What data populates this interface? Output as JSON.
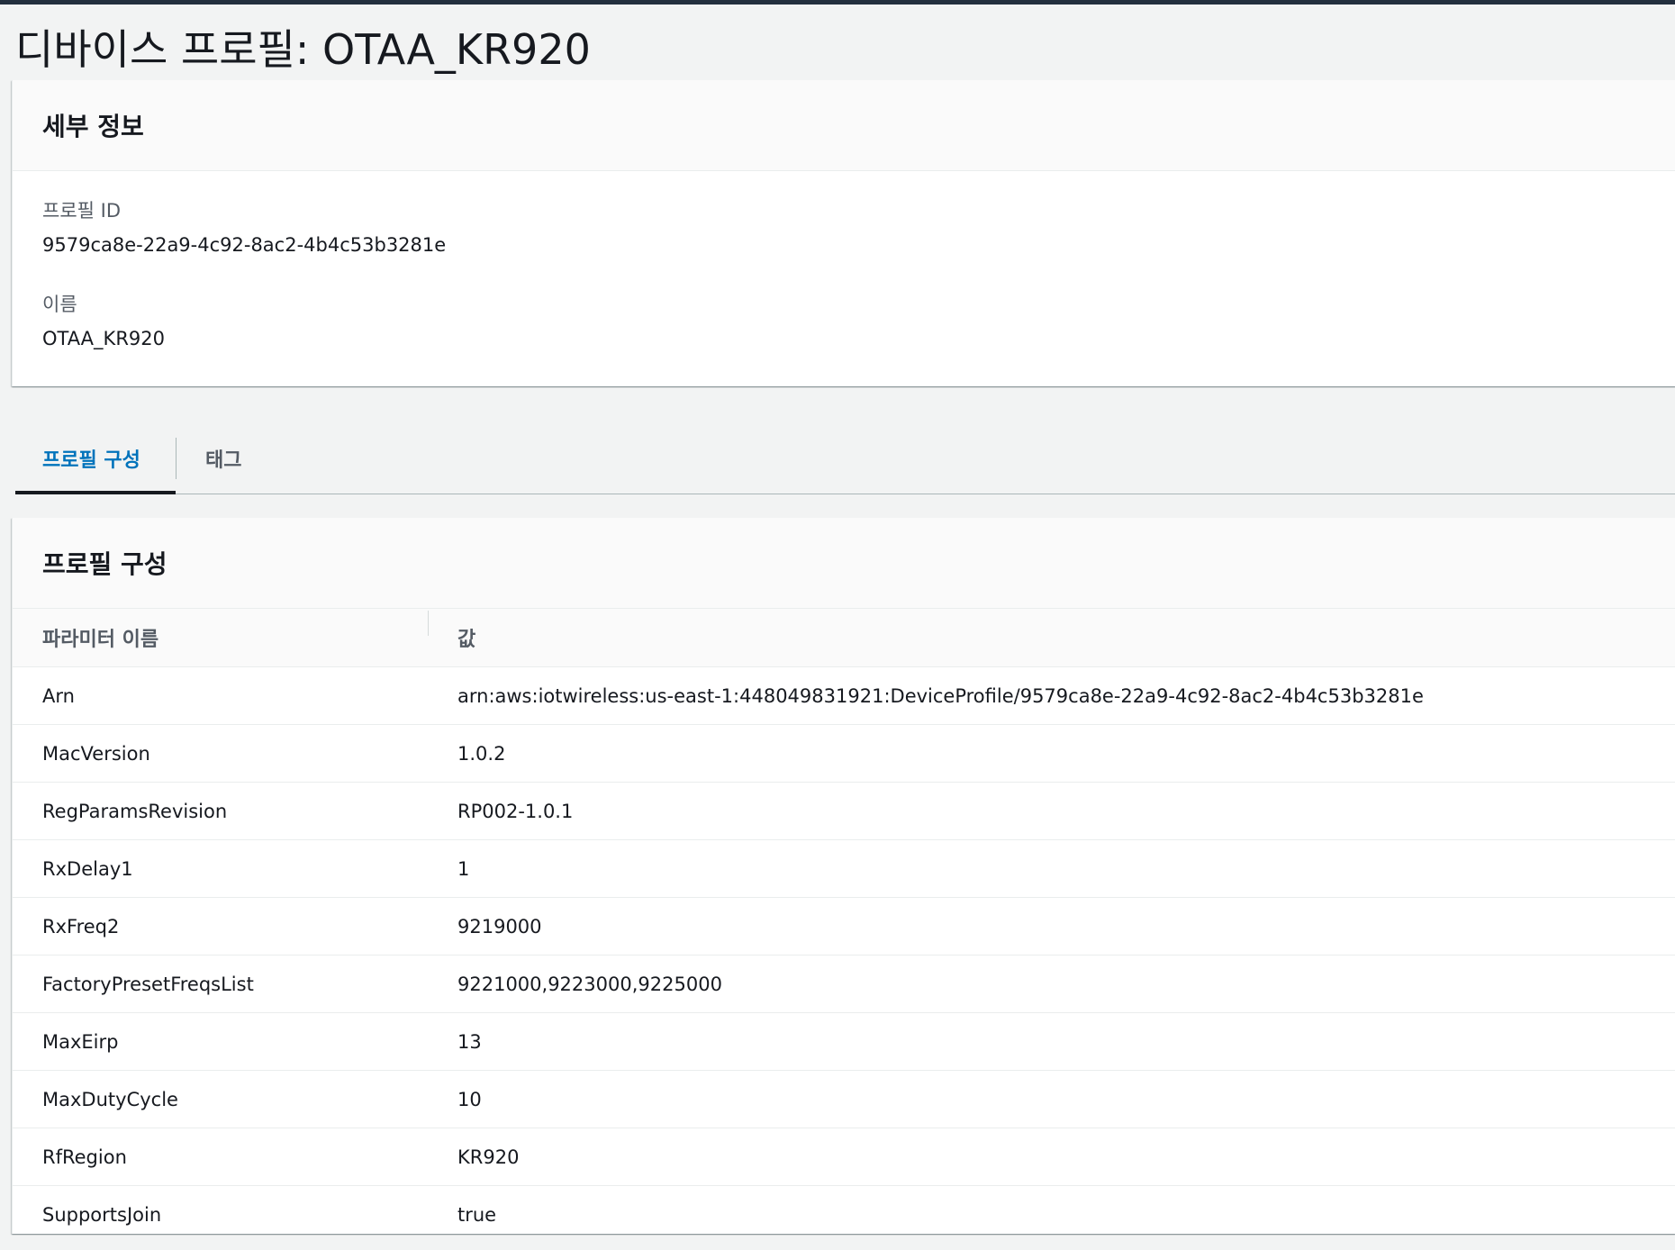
{
  "page": {
    "title": "디바이스 프로필: OTAA_KR920"
  },
  "details": {
    "heading": "세부 정보",
    "profile_id_label": "프로필 ID",
    "profile_id_value": "9579ca8e-22a9-4c92-8ac2-4b4c53b3281e",
    "name_label": "이름",
    "name_value": "OTAA_KR920"
  },
  "tabs": [
    {
      "label": "프로필 구성",
      "active": true
    },
    {
      "label": "태그",
      "active": false
    }
  ],
  "config": {
    "heading": "프로필 구성",
    "columns": [
      "파라미터 이름",
      "값"
    ],
    "rows": [
      {
        "name": "Arn",
        "value": "arn:aws:iotwireless:us-east-1:448049831921:DeviceProfile/9579ca8e-22a9-4c92-8ac2-4b4c53b3281e"
      },
      {
        "name": "MacVersion",
        "value": "1.0.2"
      },
      {
        "name": "RegParamsRevision",
        "value": "RP002-1.0.1"
      },
      {
        "name": "RxDelay1",
        "value": "1"
      },
      {
        "name": "RxFreq2",
        "value": "9219000"
      },
      {
        "name": "FactoryPresetFreqsList",
        "value": "9221000,9223000,9225000"
      },
      {
        "name": "MaxEirp",
        "value": "13"
      },
      {
        "name": "MaxDutyCycle",
        "value": "10"
      },
      {
        "name": "RfRegion",
        "value": "KR920"
      },
      {
        "name": "SupportsJoin",
        "value": "true"
      }
    ]
  },
  "colors": {
    "accent": "#0073bb",
    "background": "#f2f3f3",
    "topbar": "#232f3e"
  }
}
